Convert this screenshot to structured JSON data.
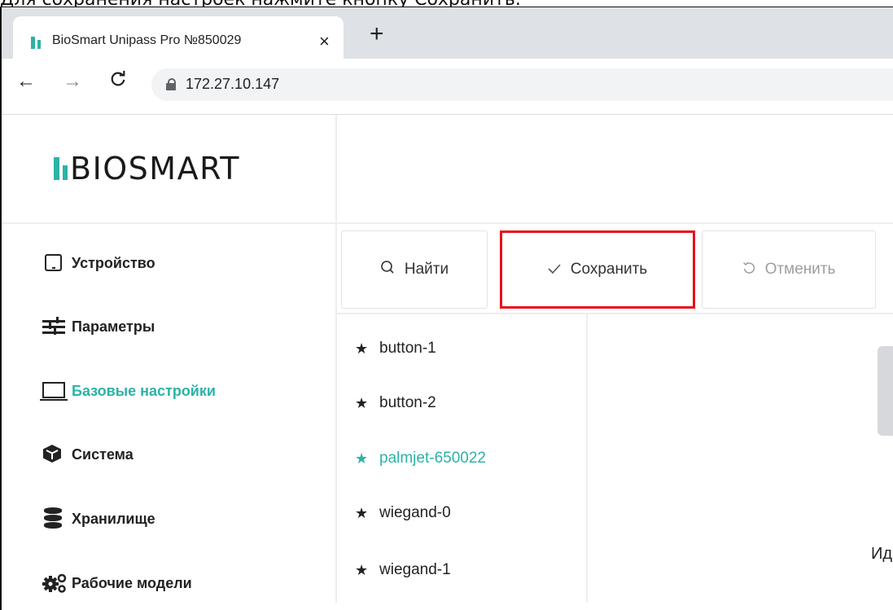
{
  "caption": "Для сохранения настроек нажмите кнопку Сохранить.",
  "browser": {
    "tab_title": "BioSmart Unipass Pro №850029",
    "tab_close": "×",
    "new_tab": "+",
    "back": "←",
    "forward": "→",
    "reload": "C",
    "url": "172.27.10.147"
  },
  "app": {
    "logo_text": "BIOSMART",
    "brand_color": "#2cb3a6",
    "sidebar": [
      {
        "label": "Устройство",
        "icon": "tablet-icon"
      },
      {
        "label": "Параметры",
        "icon": "sliders-icon"
      },
      {
        "label": "Базовые настройки",
        "icon": "laptop-icon",
        "active": true
      },
      {
        "label": "Система",
        "icon": "cube-icon"
      },
      {
        "label": "Хранилище",
        "icon": "database-icon"
      },
      {
        "label": "Рабочие модели",
        "icon": "gears-icon"
      }
    ],
    "toolbar": {
      "find_label": "Найти",
      "save_label": "Сохранить",
      "cancel_label": "Отменить"
    },
    "list": [
      {
        "label": "button-1"
      },
      {
        "label": "button-2"
      },
      {
        "label": "palmjet-650022",
        "active": true
      },
      {
        "label": "wiegand-0"
      },
      {
        "label": "wiegand-1"
      }
    ],
    "partial_label": "Ид",
    "highlight_color": "#e8101b"
  }
}
